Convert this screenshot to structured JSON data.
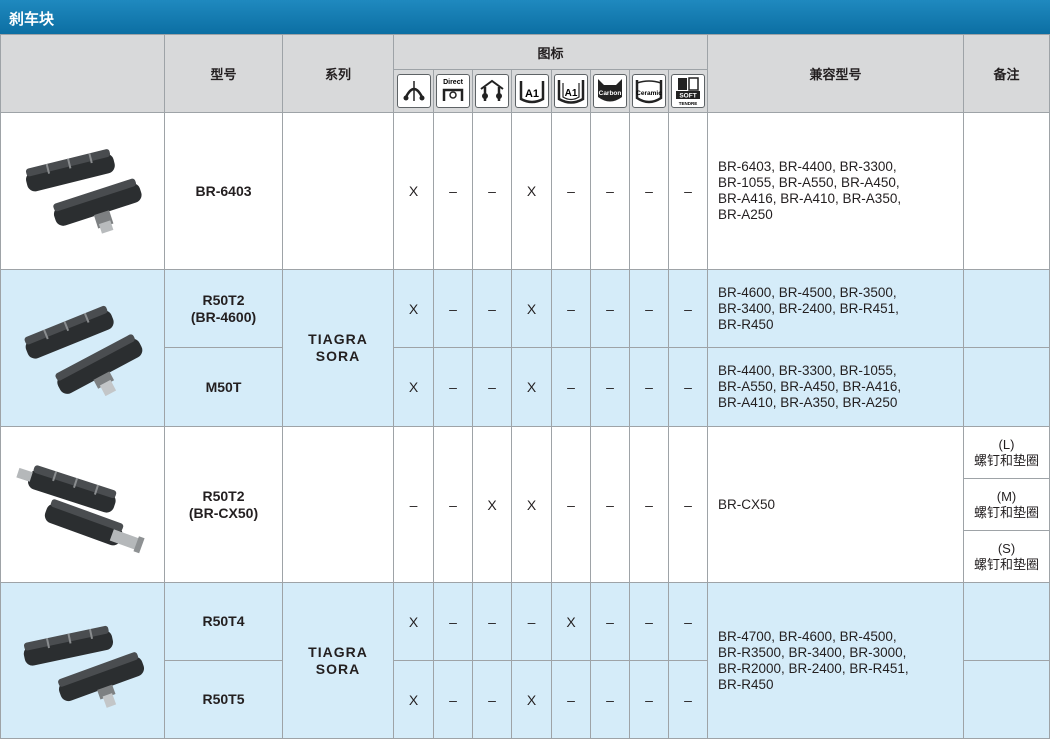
{
  "section_title": "刹车块",
  "headers": {
    "model": "型号",
    "series": "系列",
    "icons": "图标",
    "compatible": "兼容型号",
    "remarks": "备注"
  },
  "icons": [
    {
      "name": "road-caliper-icon",
      "text": ""
    },
    {
      "name": "direct-mount-icon",
      "text": "Direct"
    },
    {
      "name": "cantilever-icon",
      "text": ""
    },
    {
      "name": "aluminum-rim-icon",
      "text": "A1"
    },
    {
      "name": "aluminum-rim-alt-icon",
      "text": "A1"
    },
    {
      "name": "carbon-rim-icon",
      "text": "Carbon"
    },
    {
      "name": "ceramic-rim-icon",
      "text": "Ceramic"
    },
    {
      "name": "soft-compound-icon",
      "text": "SOFT",
      "subtext": "TENDRE"
    }
  ],
  "rows": [
    {
      "model": "BR-6403",
      "marks": [
        "X",
        "–",
        "–",
        "X",
        "–",
        "–",
        "–",
        "–"
      ],
      "compat": [
        "BR-6403, BR-4400, BR-3300,",
        "BR-1055, BR-A550, BR-A450,",
        "BR-A416, BR-A410, BR-A350,",
        "BR-A250"
      ]
    },
    {
      "model": "R50T2",
      "model2": "(BR-4600)",
      "marks": [
        "X",
        "–",
        "–",
        "X",
        "–",
        "–",
        "–",
        "–"
      ],
      "compat": [
        "BR-4600, BR-4500, BR-3500,",
        "BR-3400, BR-2400, BR-R451,",
        "BR-R450"
      ]
    },
    {
      "model": "M50T",
      "marks": [
        "X",
        "–",
        "–",
        "X",
        "–",
        "–",
        "–",
        "–"
      ],
      "compat": [
        "BR-4400, BR-3300, BR-1055,",
        "BR-A550, BR-A450, BR-A416,",
        "BR-A410, BR-A350, BR-A250"
      ]
    },
    {
      "model": "R50T2",
      "model2": "(BR-CX50)",
      "marks": [
        "–",
        "–",
        "X",
        "X",
        "–",
        "–",
        "–",
        "–"
      ],
      "compat": [
        "BR-CX50"
      ],
      "remarks": [
        {
          "size": "(L)",
          "text": "螺钉和垫圈"
        },
        {
          "size": "(M)",
          "text": "螺钉和垫圈"
        },
        {
          "size": "(S)",
          "text": "螺钉和垫圈"
        }
      ]
    },
    {
      "model": "R50T4",
      "marks": [
        "X",
        "–",
        "–",
        "–",
        "X",
        "–",
        "–",
        "–"
      ]
    },
    {
      "model": "R50T5",
      "marks": [
        "X",
        "–",
        "–",
        "X",
        "–",
        "–",
        "–",
        "–"
      ]
    }
  ],
  "series_groups": [
    {
      "line1": "TIAGRA",
      "line2": "SORA"
    },
    {
      "line1": "TIAGRA",
      "line2": "SORA"
    }
  ],
  "shared_compat": [
    "BR-4700, BR-4600, BR-4500,",
    "BR-R3500, BR-3400, BR-3000,",
    "BR-R2000, BR-2400, BR-R451,",
    "BR-R450"
  ],
  "colors": {
    "title_bar": "#0c6fa3",
    "header_bg": "#d8d9da",
    "row_blue": "#d5ecf9"
  }
}
